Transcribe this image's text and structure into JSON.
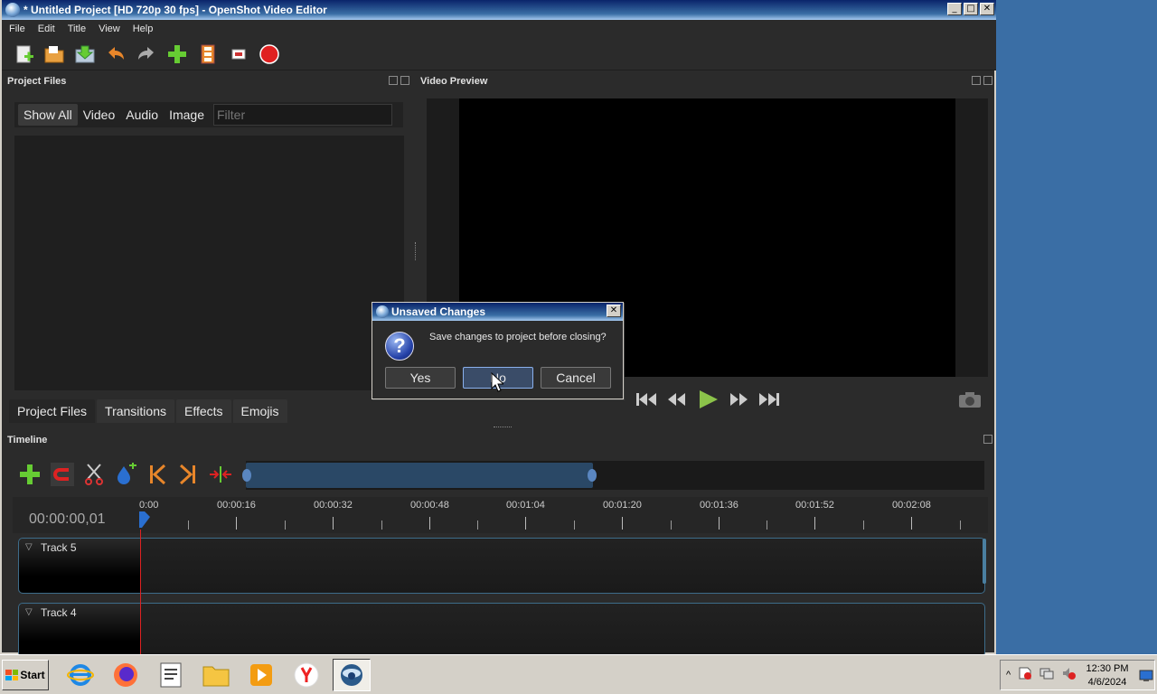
{
  "window": {
    "title": "* Untitled Project [HD 720p 30 fps] - OpenShot Video Editor",
    "controls": {
      "minimize": "_",
      "maximize": "□",
      "close": "✕"
    }
  },
  "menu": [
    "File",
    "Edit",
    "Title",
    "View",
    "Help"
  ],
  "toolbar": {
    "icons": [
      "new-project-icon",
      "open-project-icon",
      "save-project-icon",
      "undo-icon",
      "redo-icon",
      "import-files-icon",
      "choose-profile-icon",
      "fullscreen-icon",
      "export-video-icon"
    ]
  },
  "project_files": {
    "title": "Project Files",
    "filters": [
      "Show All",
      "Video",
      "Audio",
      "Image"
    ],
    "filter_placeholder": "Filter"
  },
  "bottom_tabs": [
    "Project Files",
    "Transitions",
    "Effects",
    "Emojis"
  ],
  "video_preview": {
    "title": "Video Preview",
    "controls": [
      "jump-start-icon",
      "rewind-icon",
      "play-icon",
      "fast-forward-icon",
      "jump-end-icon"
    ]
  },
  "timeline": {
    "title": "Timeline",
    "timecode": "00:00:00,01",
    "ruler_labels": [
      "0:00",
      "00:00:16",
      "00:00:32",
      "00:00:48",
      "00:01:04",
      "00:01:20",
      "00:01:36",
      "00:01:52",
      "00:02:08"
    ],
    "tracks": [
      "Track 5",
      "Track 4"
    ]
  },
  "dialog": {
    "title": "Unsaved Changes",
    "message": "Save changes to project before closing?",
    "buttons": {
      "yes": "Yes",
      "no": "No",
      "cancel": "Cancel"
    },
    "close": "✕"
  },
  "taskbar": {
    "start": "Start",
    "apps": [
      "internet-explorer-icon",
      "firefox-icon",
      "document-icon",
      "file-explorer-icon",
      "media-player-icon",
      "yandex-browser-icon",
      "openshot-icon"
    ],
    "clock_time": "12:30 PM",
    "clock_date": "4/6/2024",
    "tray_expand": "^"
  },
  "colors": {
    "accent": "#3a6ea5",
    "dark_bg": "#2b2b2b",
    "play_green": "#8bc34a",
    "record_red": "#e02020"
  }
}
